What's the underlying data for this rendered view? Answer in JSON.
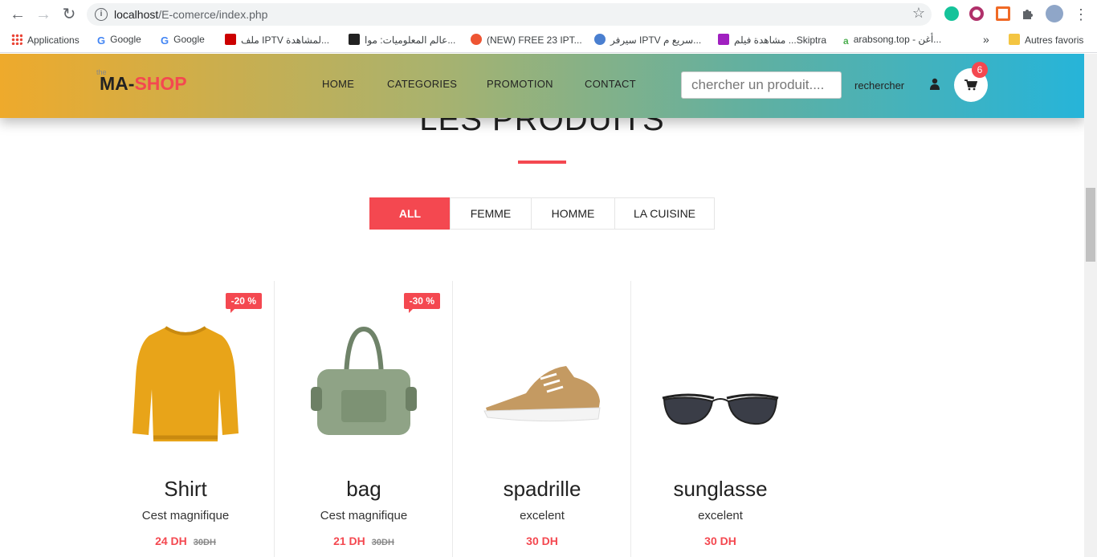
{
  "browser": {
    "url_host": "localhost",
    "url_path": "/E-comerce/index.php"
  },
  "bookmarks": [
    {
      "label": "Applications",
      "icon": "apps-grid-icon"
    },
    {
      "label": "Google",
      "icon": "google-icon"
    },
    {
      "label": "Google",
      "icon": "google-icon"
    },
    {
      "label": "ملف IPTV لمشاهدة...",
      "icon": "site-icon"
    },
    {
      "label": "عالم المعلوميات: موا...",
      "icon": "site-icon"
    },
    {
      "label": "(NEW) FREE 23 IPT...",
      "icon": "site-icon"
    },
    {
      "label": "سيرفر IPTV سريع م...",
      "icon": "site-icon"
    },
    {
      "label": "مشاهدة فيلم ...Skiptra",
      "icon": "youtube-icon"
    },
    {
      "label": "arabsong.top - أغن...",
      "icon": "site-icon"
    },
    {
      "label": "»",
      "icon": ""
    },
    {
      "label": "Autres favoris",
      "icon": "folder-icon"
    }
  ],
  "header": {
    "logo_small": "the",
    "logo_part1": "MA-",
    "logo_part2": "SHOP",
    "menu": [
      "HOME",
      "CATEGORIES",
      "PROMOTION",
      "CONTACT"
    ],
    "search_placeholder": "chercher un produit....",
    "search_button": "rechercher",
    "cart_count": "6"
  },
  "section": {
    "title": "LES PRODUITS"
  },
  "filters": [
    {
      "label": "ALL",
      "active": true
    },
    {
      "label": "FEMME",
      "active": false
    },
    {
      "label": "HOMME",
      "active": false
    },
    {
      "label": "LA CUISINE",
      "active": false
    }
  ],
  "products": [
    {
      "name": "Shirt",
      "desc": "Cest magnifique",
      "price": "24 DH",
      "old_price": "30DH",
      "badge": "-20 %",
      "image": "yellow-sweater"
    },
    {
      "name": "bag",
      "desc": "Cest magnifique",
      "price": "21 DH",
      "old_price": "30DH",
      "badge": "-30 %",
      "image": "green-duffel-bag"
    },
    {
      "name": "spadrille",
      "desc": "excelent",
      "price": "30 DH",
      "old_price": "",
      "badge": "",
      "image": "tan-sneaker"
    },
    {
      "name": "sunglasse",
      "desc": "excelent",
      "price": "30 DH",
      "old_price": "",
      "badge": "",
      "image": "aviator-sunglasses"
    }
  ],
  "colors": {
    "accent": "#f44850",
    "header_gradient": [
      "#eeaa2c",
      "#26b4d9"
    ]
  }
}
